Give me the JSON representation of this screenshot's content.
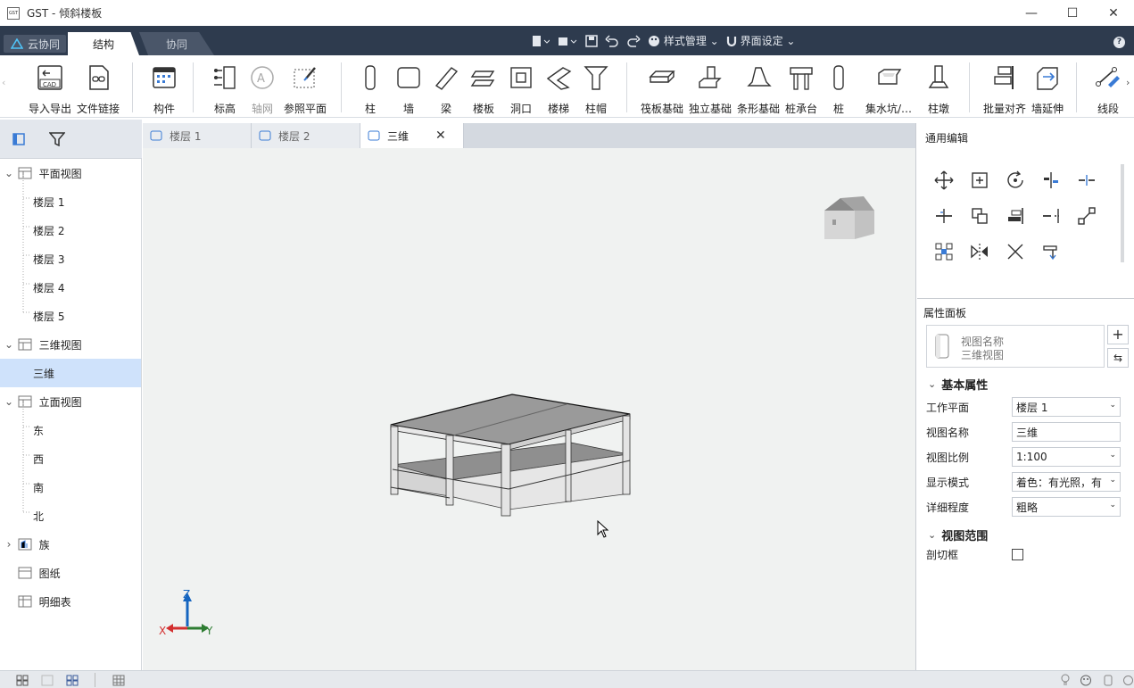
{
  "window": {
    "title": "GST - 倾斜楼板",
    "logo_text": "GST"
  },
  "window_controls": {
    "min": "—",
    "max": "☐",
    "close": "✕"
  },
  "top_tabs": {
    "cloud": "云协同",
    "structure": "结构",
    "collab": "协同"
  },
  "top_right": {
    "style_mgmt": "样式管理",
    "ui_settings": "界面设定",
    "help": "?"
  },
  "ribbon": {
    "import_export": "导入导出",
    "file_link": "文件链接",
    "component": "构件",
    "elevation": "标高",
    "axis_grid": "轴网",
    "ref_plane": "参照平面",
    "column": "柱",
    "wall": "墙",
    "beam": "梁",
    "slab": "楼板",
    "opening": "洞口",
    "stair": "楼梯",
    "capital": "柱帽",
    "raft": "筏板基础",
    "isolated": "独立基础",
    "strip": "条形基础",
    "pile_cap": "桩承台",
    "pile": "桩",
    "sump": "集水坑/…",
    "pier": "柱墩",
    "batch_align": "批量对齐",
    "wall_extend": "墙延伸",
    "segment": "线段",
    "cad_text": "CAD"
  },
  "tree": {
    "plan_views": "平面视图",
    "floor1": "楼层 1",
    "floor2": "楼层 2",
    "floor3": "楼层 3",
    "floor4": "楼层 4",
    "floor5": "楼层 5",
    "views_3d": "三维视图",
    "view_3d": "三维",
    "elevation_views": "立面视图",
    "east": "东",
    "west": "西",
    "south": "南",
    "north": "北",
    "family": "族",
    "sheets": "图纸",
    "schedules": "明细表"
  },
  "doc_tabs": {
    "tab1": "楼层 1",
    "tab2": "楼层 2",
    "tab3": "三维",
    "close": "✕"
  },
  "axes": {
    "z": "Z",
    "x": "X",
    "y": "Y"
  },
  "edit_panel": {
    "title": "通用编辑"
  },
  "props": {
    "title": "属性面板",
    "view_name_label": "视图名称",
    "view_type": "三维视图",
    "basic_section": "基本属性",
    "work_plane_label": "工作平面",
    "work_plane": "楼层 1",
    "view_name_field_label": "视图名称",
    "view_name": "三维",
    "scale_label": "视图比例",
    "scale": "1:100",
    "display_label": "显示模式",
    "display": "着色：有光照，有",
    "detail_label": "详细程度",
    "detail": "粗略",
    "range_section": "视图范围",
    "section_box_label": "剖切框"
  },
  "colors": {
    "dark_bar": "#2e3b4e",
    "selected": "#cfe2fb",
    "viewport": "#f0f2f1",
    "accent": "#3a7bd5"
  }
}
